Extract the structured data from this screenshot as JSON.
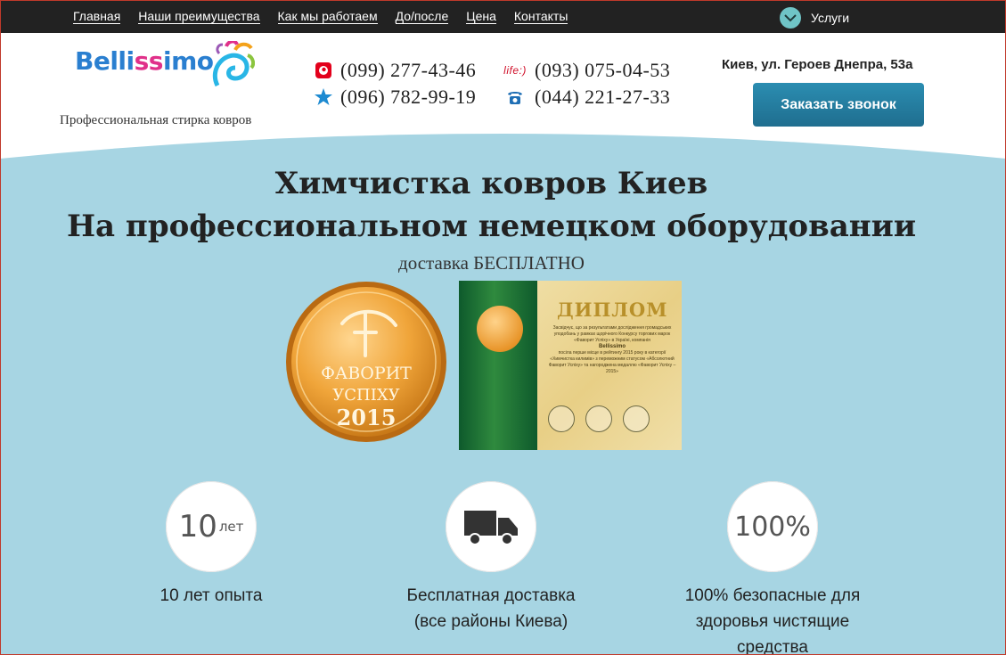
{
  "nav": {
    "items": [
      {
        "label": "Главная"
      },
      {
        "label": "Наши преимущества"
      },
      {
        "label": "Как мы работаем"
      },
      {
        "label": "До/после"
      },
      {
        "label": "Цена"
      },
      {
        "label": "Контакты"
      }
    ],
    "services_label": "Услуги"
  },
  "header": {
    "logo_text": "Bellissimo",
    "tagline": "Профессиональная стирка ковров",
    "phones": [
      {
        "number": "(099) 277-43-46",
        "icon": "vodafone-icon"
      },
      {
        "number": "(093) 075-04-53",
        "icon": "life-icon"
      },
      {
        "number": "(096) 782-99-19",
        "icon": "kyivstar-icon"
      },
      {
        "number": "(044) 221-27-33",
        "icon": "landline-phone-icon"
      }
    ],
    "life_label": "life:)",
    "address": "Киев, ул. Героев Днепра, 53а",
    "call_button": "Заказать звонок"
  },
  "hero": {
    "title_line1": "Химчистка ковров Киев",
    "title_line2": "На профессиональном немецком оборудовании",
    "subtitle": "доставка БЕСПЛАТНО",
    "medal": {
      "line1": "ФАВОРИТ",
      "line2": "УСПІХУ",
      "year": "2015"
    },
    "diploma": {
      "title": "ДИПЛОМ",
      "text": "Засвідчує, що за результатами дослідження громадських уподобань у рамках щорічного Конкурсу торгових марок «Фаворит Успіху» в Україні, компанія",
      "company": "Bellissimo",
      "text2": "посіла перше місце в рейтингу 2015 року в категорії «Химчистка килимів» з переможним статусом «Абсолютний Фаворит Успіху» та нагороджена медаллю «Фаворит Успіху – 2015»"
    }
  },
  "features": [
    {
      "icon_big": "10",
      "icon_small": "лет",
      "line1": "10 лет опыта",
      "line2": "",
      "line3": ""
    },
    {
      "icon": "truck-icon",
      "line1": "Бесплатная доставка",
      "line2": "(все районы Киева)",
      "line3": ""
    },
    {
      "icon_big": "100%",
      "line1": "100% безопасные для",
      "line2": "здоровья чистящие",
      "line3": "средства"
    }
  ],
  "colors": {
    "nav_bg": "#222222",
    "hero_bg": "#a7d5e3",
    "accent": "#2589ad",
    "service_circle": "#6fc4c6"
  }
}
